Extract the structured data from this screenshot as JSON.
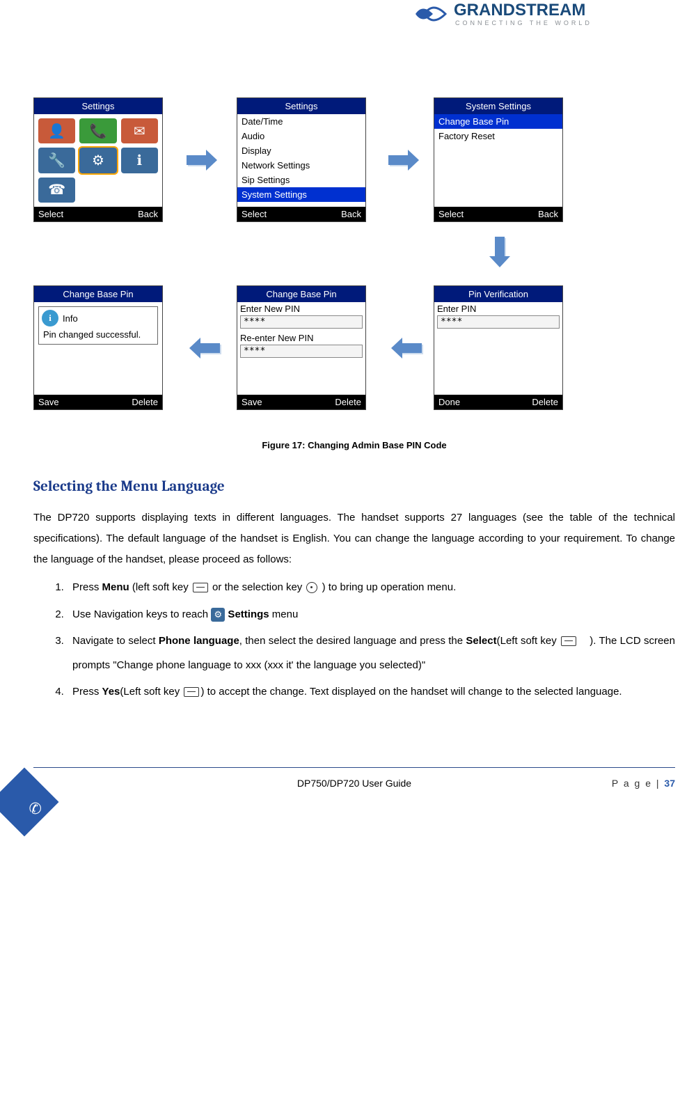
{
  "logo": {
    "brand": "GRANDSTREAM",
    "tagline": "CONNECTING THE WORLD"
  },
  "screens": {
    "s1": {
      "title": "Settings",
      "soft": {
        "left": "Select",
        "right": "Back"
      }
    },
    "s2": {
      "title": "Settings",
      "items": [
        "Date/Time",
        "Audio",
        "Display",
        "Network Settings",
        "Sip Settings",
        "System Settings"
      ],
      "selected_index": 5,
      "soft": {
        "left": "Select",
        "right": "Back"
      }
    },
    "s3": {
      "title": "System Settings",
      "items": [
        "Change Base Pin",
        "Factory Reset"
      ],
      "selected_index": 0,
      "soft": {
        "left": "Select",
        "right": "Back"
      }
    },
    "s4": {
      "title": "Pin Verification",
      "label1": "Enter PIN",
      "value1": "****",
      "soft": {
        "left": "Done",
        "right": "Delete"
      }
    },
    "s5": {
      "title": "Change Base Pin",
      "label1": "Enter New PIN",
      "value1": "****",
      "label2": "Re-enter New PIN",
      "value2": "****",
      "soft": {
        "left": "Save",
        "right": "Delete"
      }
    },
    "s6": {
      "title": "Change Base Pin",
      "info_title": "Info",
      "info_body": "Pin changed successful.",
      "soft": {
        "left": "Save",
        "right": "Delete"
      }
    }
  },
  "figure_caption": "Figure 17: Changing Admin Base PIN Code",
  "section_heading": "Selecting the Menu Language",
  "intro": "The DP720 supports displaying texts in different languages. The handset supports 27 languages (see the table of the technical specifications). The default language of the handset is English. You can change the language according to your requirement. To change the language of the handset, please proceed as follows:",
  "steps": {
    "s1a": "Press ",
    "s1b": "Menu",
    "s1c": " (left soft key ",
    "s1d": " or the selection key ",
    "s1e": " ) to bring up operation menu.",
    "s2a": "Use Navigation keys to reach ",
    "s2b": " Settings",
    "s2c": " menu",
    "s3a": "Navigate to select ",
    "s3b": "Phone language",
    "s3c": ", then select the desired language and press the ",
    "s3d": "Select",
    "s3e": "(Left soft key ",
    "s3f": "). The LCD screen prompts \"Change phone language to xxx (xxx it' the language you selected)\"",
    "s4a": "Press ",
    "s4b": "Yes",
    "s4c": "(Left soft key  ",
    "s4d": ") to accept the change. Text displayed on the handset will change to the selected language."
  },
  "footer": {
    "center": "DP750/DP720 User Guide",
    "right_label": "P a g e | ",
    "page_num": "37"
  }
}
